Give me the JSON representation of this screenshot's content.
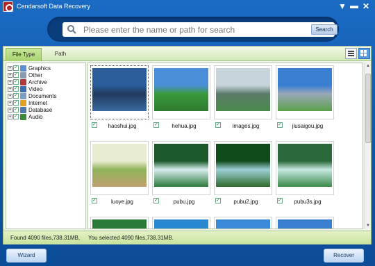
{
  "window": {
    "title": "Cendarsoft Data Recovery"
  },
  "search": {
    "placeholder": "Please enter the name or path for search",
    "button": "Search"
  },
  "tabs": [
    {
      "label": "File Type"
    },
    {
      "label": "Path"
    }
  ],
  "tree": [
    {
      "label": "Graphics",
      "icon": "graphics-icon",
      "color": "#5a8fd1"
    },
    {
      "label": "Other",
      "icon": "other-icon",
      "color": "#8a9bb0"
    },
    {
      "label": "Archive",
      "icon": "archive-icon",
      "color": "#b33a3a"
    },
    {
      "label": "Video",
      "icon": "video-icon",
      "color": "#3a6fb0"
    },
    {
      "label": "Documents",
      "icon": "documents-icon",
      "color": "#7aa0c8"
    },
    {
      "label": "Internet",
      "icon": "internet-icon",
      "color": "#e0a020"
    },
    {
      "label": "Database",
      "icon": "database-icon",
      "color": "#4a7ab0"
    },
    {
      "label": "Audio",
      "icon": "audio-icon",
      "color": "#3a8a3a"
    }
  ],
  "files": [
    {
      "name": "haoshui.jpg",
      "sky": "#2a5d9a",
      "mid": "#223a5e",
      "ground": "#3a6aa0"
    },
    {
      "name": "hehua.jpg",
      "sky": "#4a8fd8",
      "mid": "#3a9a3a",
      "ground": "#2f7a30"
    },
    {
      "name": "images.jpg",
      "sky": "#c8d4dc",
      "mid": "#5a7a6a",
      "ground": "#4a8a4a"
    },
    {
      "name": "jiusaigou.jpg",
      "sky": "#3a7ed0",
      "mid": "#9aa8b8",
      "ground": "#5aa04a"
    },
    {
      "name": "luoye.jpg",
      "sky": "#e8ecd0",
      "mid": "#8fb35a",
      "ground": "#c0a070"
    },
    {
      "name": "pubu.jpg",
      "sky": "#1a5a2a",
      "mid": "#d8eef0",
      "ground": "#2a7a3a"
    },
    {
      "name": "pubu2.jpg",
      "sky": "#0f4a1a",
      "mid": "#9fd0d8",
      "ground": "#2f6a2a"
    },
    {
      "name": "pubu3s.jpg",
      "sky": "#2a6a3a",
      "mid": "#c8e8e0",
      "ground": "#3a8a4a"
    },
    {
      "name": "",
      "sky": "#2a7a3a",
      "mid": "#2a7a3a",
      "ground": "#2a7a3a"
    },
    {
      "name": "",
      "sky": "#2a88d0",
      "mid": "#2a88d0",
      "ground": "#2a88d0"
    },
    {
      "name": "",
      "sky": "#3a8ad8",
      "mid": "#3a8ad8",
      "ground": "#3a8ad8"
    },
    {
      "name": "",
      "sky": "#3a7ed0",
      "mid": "#3a7ed0",
      "ground": "#3a7ed0"
    }
  ],
  "status": {
    "found": "Found 4090 files,738.31MB,",
    "selected": "You selected 4090 files,738.31MB."
  },
  "buttons": {
    "wizard": "Wizard",
    "recover": "Recover"
  }
}
